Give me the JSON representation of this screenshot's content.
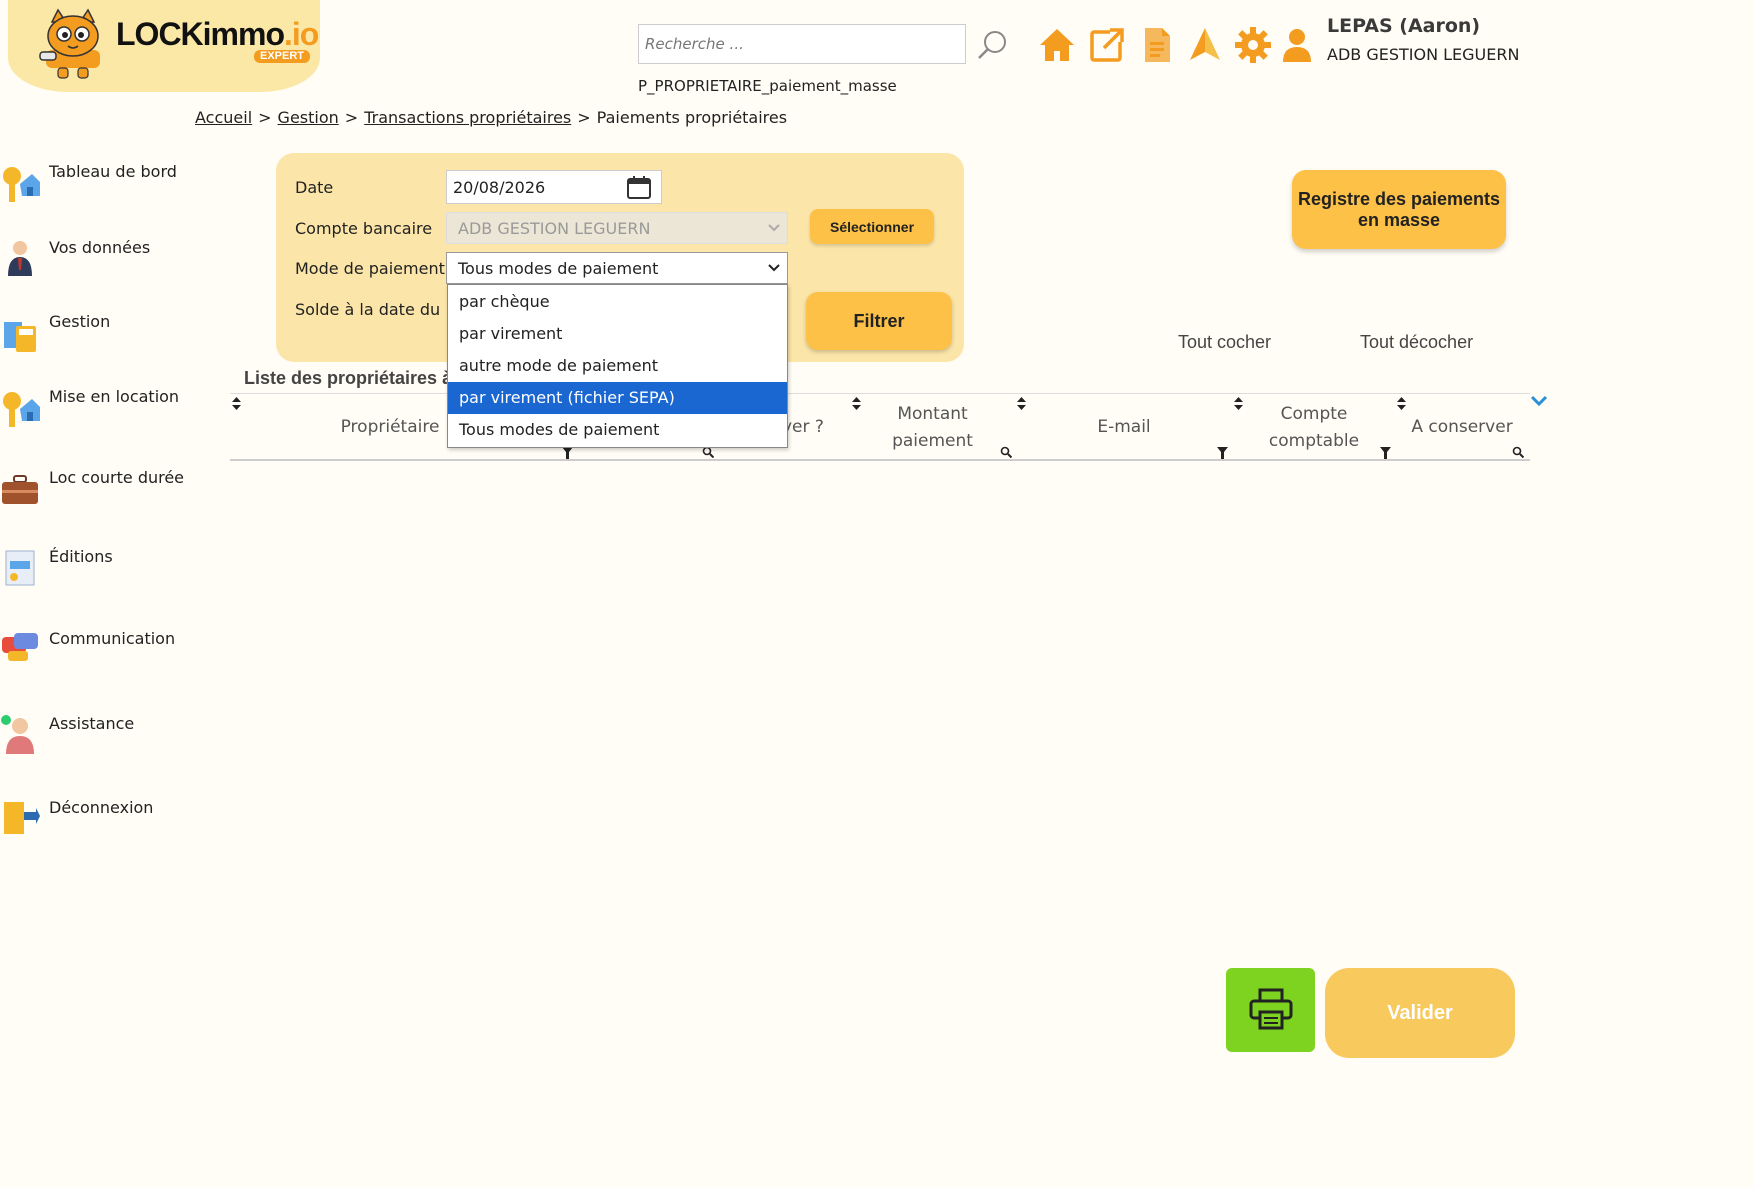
{
  "header": {
    "logo": {
      "name": "LOCKimmo",
      "tld": ".io",
      "badge": "EXPERT"
    },
    "search": {
      "placeholder": "Recherche ..."
    },
    "page_code": "P_PROPRIETAIRE_paiement_masse",
    "user": {
      "name": "LEPAS (Aaron)",
      "agency": "ADB GESTION LEGUERN"
    },
    "icons": [
      "home-icon",
      "external-link-icon",
      "document-icon",
      "alert-icon",
      "settings-icon",
      "user-icon"
    ]
  },
  "breadcrumb": {
    "items": [
      "Accueil",
      "Gestion",
      "Transactions propriétaires"
    ],
    "current": "Paiements propriétaires",
    "separator": ">"
  },
  "sidebar": {
    "items": [
      {
        "label": "Tableau de bord",
        "icon": "keys-house-icon"
      },
      {
        "label": "Vos données",
        "icon": "businessman-icon"
      },
      {
        "label": "Gestion",
        "icon": "calculator-icon"
      },
      {
        "label": "Mise en location",
        "icon": "keys-house-icon"
      },
      {
        "label": "Loc courte durée",
        "icon": "suitcase-icon"
      },
      {
        "label": "Éditions",
        "icon": "report-icon"
      },
      {
        "label": "Communication",
        "icon": "chat-bubbles-icon"
      },
      {
        "label": "Assistance",
        "icon": "support-agent-icon"
      },
      {
        "label": "Déconnexion",
        "icon": "logout-door-icon"
      }
    ]
  },
  "filter": {
    "date_label": "Date",
    "date_value": "20/08/2026",
    "bank_label": "Compte bancaire",
    "bank_value": "ADB GESTION LEGUERN",
    "select_button": "Sélectionner",
    "mode_label": "Mode de paiement",
    "mode_value": "Tous modes de paiement",
    "balance_label": "Solde à la date du",
    "filter_button": "Filtrer",
    "mode_options": [
      "par chèque",
      "par virement",
      "autre mode de paiement",
      "par virement (fichier SEPA)",
      "Tous modes de paiement"
    ],
    "mode_highlighted_index": 3
  },
  "actions": {
    "register_button": "Registre des paiements en masse",
    "check_all": "Tout cocher",
    "uncheck_all": "Tout décocher",
    "validate_button": "Valider"
  },
  "table": {
    "title": "Liste des propriétaires à",
    "columns": {
      "owner": "Propriétaire",
      "pay_partial": "yer ?",
      "amount": "Montant paiement",
      "email": "E-mail",
      "account": "Compte comptable",
      "keep": "A conserver"
    }
  },
  "colors": {
    "accent": "#fcc146",
    "panel": "#fbe5a8",
    "highlight": "#1a67d2",
    "print": "#7ed321",
    "icon_orange": "#f39c1f"
  }
}
